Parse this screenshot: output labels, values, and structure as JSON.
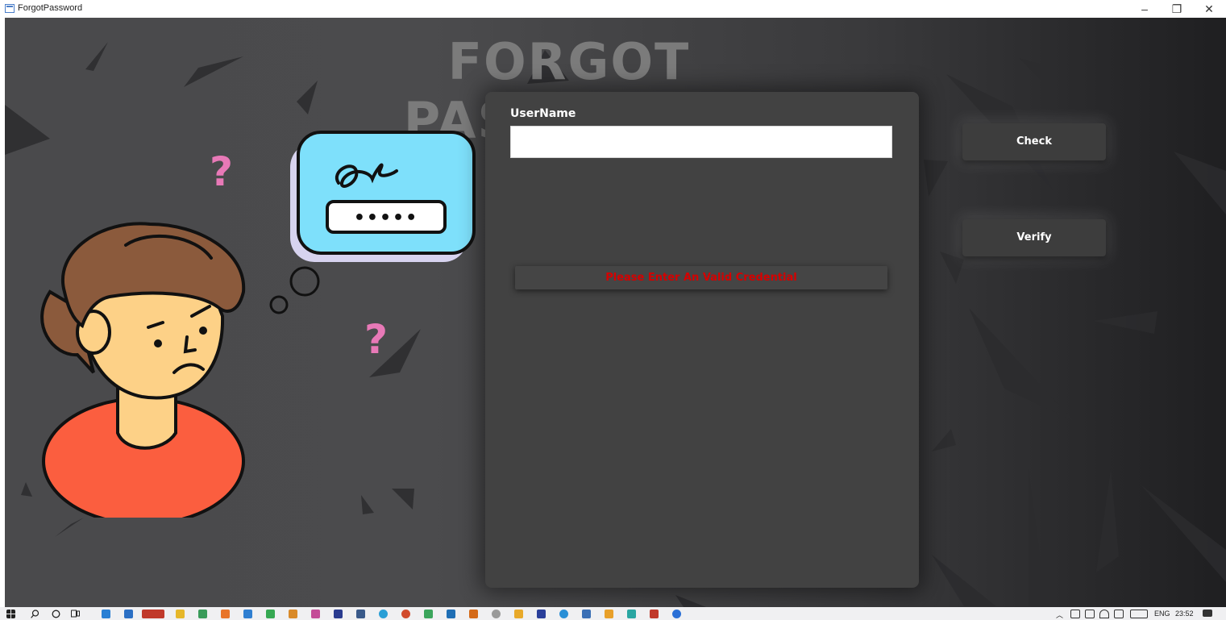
{
  "window": {
    "title": "ForgotPassword",
    "minimize_glyph": "–",
    "restore_glyph": "❐",
    "close_glyph": "✕"
  },
  "header": {
    "title": "FORGOT PASSWORD"
  },
  "illustration": {
    "question_mark": "?",
    "password_dots": "•••••"
  },
  "form": {
    "username_label": "UserName",
    "username_value": "",
    "error_message": "Please Enter An Valid Credential"
  },
  "actions": {
    "check_label": "Check",
    "verify_label": "Verify"
  },
  "taskbar": {
    "language": "ENG",
    "time": "23:52"
  },
  "colors": {
    "error": "#d50000",
    "question_marks": "#e879b7",
    "thought_bubble": "#7ee0fb",
    "shirt": "#fb5e3f",
    "hair": "#8b5a3c",
    "skin": "#fdd187"
  }
}
